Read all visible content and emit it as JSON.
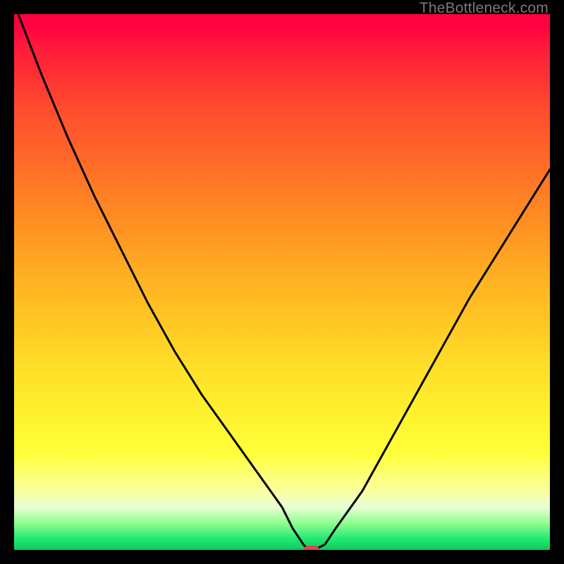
{
  "watermark": "TheBottleneck.com",
  "colors": {
    "curve_stroke": "#000000",
    "marker_fill": "#d64a4a",
    "frame": "#000000"
  },
  "chart_data": {
    "type": "line",
    "title": "",
    "xlabel": "",
    "ylabel": "",
    "xlim": [
      0,
      100
    ],
    "ylim": [
      0,
      100
    ],
    "series": [
      {
        "name": "bottleneck-curve",
        "x": [
          0,
          5,
          10,
          15,
          20,
          25,
          30,
          35,
          40,
          45,
          50,
          52,
          54,
          55,
          56,
          58,
          60,
          65,
          70,
          75,
          80,
          85,
          90,
          95,
          100
        ],
        "y": [
          102,
          89,
          77,
          66,
          56,
          46,
          37,
          29,
          22,
          15,
          8,
          4,
          1,
          0,
          0,
          1,
          4,
          11,
          20,
          29,
          38,
          47,
          55,
          63,
          71
        ]
      }
    ],
    "marker": {
      "x": 55.5,
      "y": 0
    },
    "gradient_stops": [
      {
        "pct": 0,
        "color": "#ff0040"
      },
      {
        "pct": 50,
        "color": "#ffb322"
      },
      {
        "pct": 82,
        "color": "#ffff3a"
      },
      {
        "pct": 100,
        "color": "#10c860"
      }
    ]
  }
}
